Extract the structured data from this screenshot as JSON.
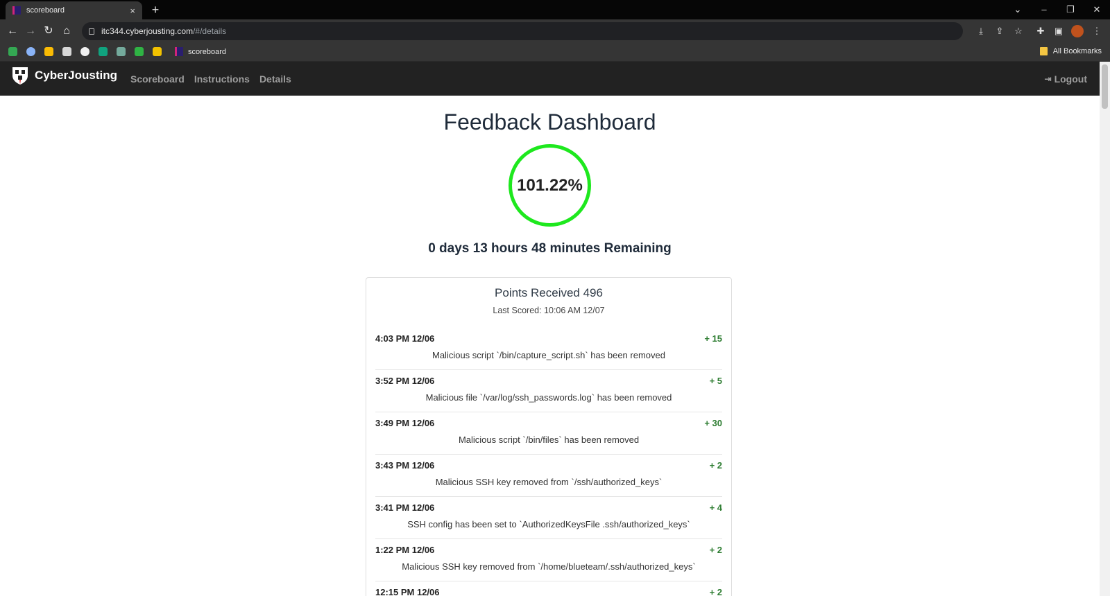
{
  "browser": {
    "tab_title": "scoreboard",
    "tab_close": "×",
    "new_tab": "+",
    "url_host": "itc344.cyberjousting.com",
    "url_path": "/#/details",
    "bookmark_label": "scoreboard",
    "all_bookmarks": "All Bookmarks"
  },
  "navbar": {
    "brand": "CyberJousting",
    "links": [
      "Scoreboard",
      "Instructions",
      "Details"
    ],
    "logout": "Logout"
  },
  "dashboard": {
    "title": "Feedback Dashboard",
    "score_percent": "101.22%",
    "remaining": "0 days 13 hours 48 minutes Remaining",
    "points_received": "Points Received 496",
    "last_scored": "Last Scored: 10:06 AM 12/07",
    "entries": [
      {
        "time": "4:03 PM 12/06",
        "points": "+ 15",
        "message": "Malicious script `/bin/capture_script.sh` has been removed"
      },
      {
        "time": "3:52 PM 12/06",
        "points": "+ 5",
        "message": "Malicious file `/var/log/ssh_passwords.log` has been removed"
      },
      {
        "time": "3:49 PM 12/06",
        "points": "+ 30",
        "message": "Malicious script `/bin/files` has been removed"
      },
      {
        "time": "3:43 PM 12/06",
        "points": "+ 2",
        "message": "Malicious SSH key removed from `/ssh/authorized_keys`"
      },
      {
        "time": "3:41 PM 12/06",
        "points": "+ 4",
        "message": "SSH config has been set to `AuthorizedKeysFile .ssh/authorized_keys`"
      },
      {
        "time": "1:22 PM 12/06",
        "points": "+ 2",
        "message": "Malicious SSH key removed from `/home/blueteam/.ssh/authorized_keys`"
      },
      {
        "time": "12:15 PM 12/06",
        "points": "+ 2",
        "message": ""
      }
    ]
  },
  "colors": {
    "ring": "#1ee81e",
    "points_green": "#2e7d32",
    "navbar_bg": "#222222"
  }
}
